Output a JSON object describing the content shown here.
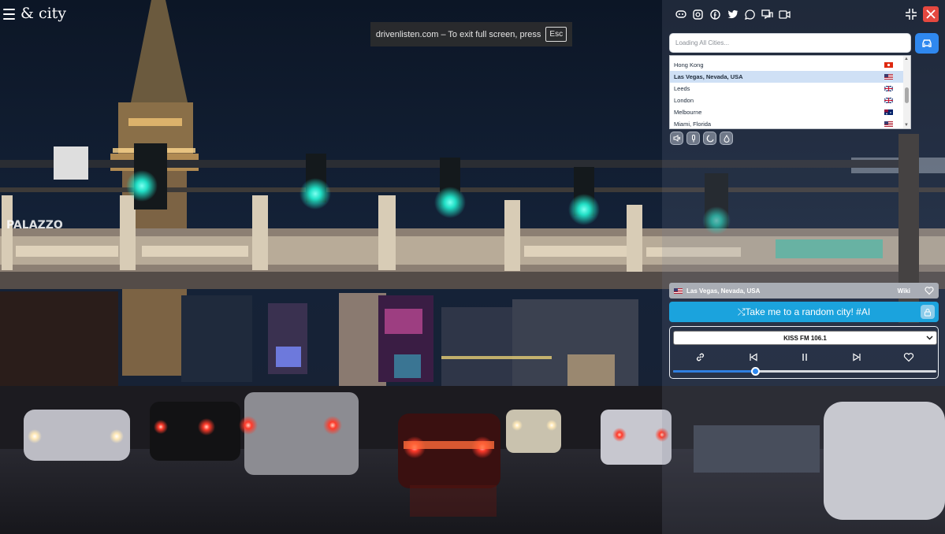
{
  "brand": {
    "logo": "& city"
  },
  "fullscreen_notice": {
    "text": "drivenlisten.com – To exit full screen, press",
    "key": "Esc"
  },
  "top_icons": [
    "discord-icon",
    "instagram-icon",
    "facebook-icon",
    "twitter-icon",
    "whatsapp-icon",
    "chat-icon",
    "video-icon"
  ],
  "search": {
    "placeholder": "Loading All Cities..."
  },
  "city_list": [
    {
      "name": "Hong Kong",
      "flag": "hk"
    },
    {
      "name": "Las Vegas, Nevada, USA",
      "flag": "us"
    },
    {
      "name": "Leeds",
      "flag": "gb"
    },
    {
      "name": "London",
      "flag": "gb"
    },
    {
      "name": "Melbourne",
      "flag": "au"
    },
    {
      "name": "Miami, Florida",
      "flag": "us"
    }
  ],
  "selected_city_index": 1,
  "controls": [
    "mute-icon",
    "microphone-icon",
    "moon-icon",
    "drop-icon"
  ],
  "location_bar": {
    "city": "Las Vegas, Nevada, USA",
    "wiki": "Wiki"
  },
  "random_button": {
    "label": "⤭Take me to a random city! #AI"
  },
  "player": {
    "station": "KISS FM 106.1",
    "progress": 0.31
  },
  "colors": {
    "accent_blue": "#2f88ef",
    "random_cyan": "#1ba3dd",
    "close_red": "#e5483f",
    "selected_row": "#cfe0f5"
  }
}
